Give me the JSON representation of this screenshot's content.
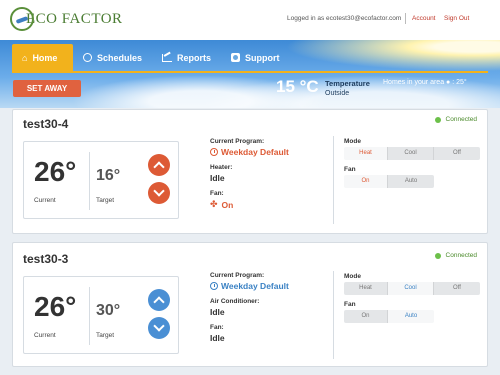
{
  "brand": {
    "name": "ECO FACTOR"
  },
  "header": {
    "logged_in_text": "Logged in as ecotest30@ecofactor.com",
    "account_label": "Account",
    "signout_label": "Sign Out"
  },
  "nav": {
    "tabs": [
      {
        "label": "Home",
        "icon": "home-icon",
        "active": true
      },
      {
        "label": "Schedules",
        "icon": "clock-icon",
        "active": false
      },
      {
        "label": "Reports",
        "icon": "chart-icon",
        "active": false
      },
      {
        "label": "Support",
        "icon": "support-icon",
        "active": false
      }
    ]
  },
  "set_away_label": "SET AWAY",
  "outside": {
    "temp": "15 °C",
    "label_top": "Temperature",
    "label_bottom": "Outside",
    "homes_text": "Homes in your area",
    "homes_temp": "25°"
  },
  "thermostats": [
    {
      "name": "test30-4",
      "status": "Connected",
      "current_value": "26°",
      "current_label": "Current",
      "target_value": "16°",
      "target_label": "Target",
      "accent": "#dd5a35",
      "program_label": "Current Program:",
      "program_value": "Weekday Default",
      "equip_label": "Heater:",
      "equip_value": "Idle",
      "fan_label": "Fan:",
      "fan_value": "On",
      "mode_label": "Mode",
      "mode_options": [
        "Heat",
        "Cool",
        "Off"
      ],
      "mode_selected": "Heat",
      "fan_ctl_label": "Fan",
      "fan_options": [
        "On",
        "Auto"
      ],
      "fan_selected": "On"
    },
    {
      "name": "test30-3",
      "status": "Connected",
      "current_value": "26°",
      "current_label": "Current",
      "target_value": "30°",
      "target_label": "Target",
      "accent": "#4a8fd4",
      "program_label": "Current Program:",
      "program_value": "Weekday Default",
      "equip_label": "Air Conditioner:",
      "equip_value": "Idle",
      "fan_label": "Fan:",
      "fan_value": "Idle",
      "mode_label": "Mode",
      "mode_options": [
        "Heat",
        "Cool",
        "Off"
      ],
      "mode_selected": "Cool",
      "fan_ctl_label": "Fan",
      "fan_options": [
        "On",
        "Auto"
      ],
      "fan_selected": "Auto"
    }
  ]
}
